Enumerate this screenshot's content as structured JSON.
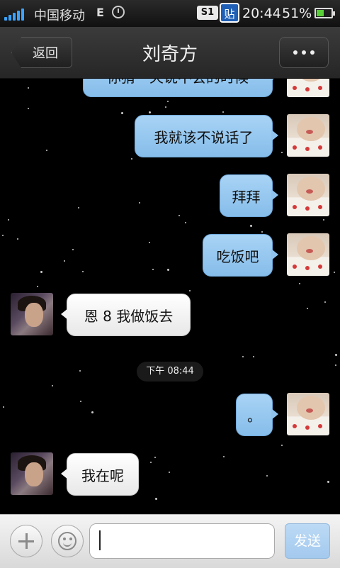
{
  "status_bar": {
    "carrier": "中国移动",
    "network": "E",
    "sim_label": "S1",
    "sticker_label": "贴",
    "time": "20:44",
    "battery_percent": "51%",
    "battery_level": 0.51
  },
  "header": {
    "back_label": "返回",
    "title": "刘奇方"
  },
  "messages": [
    {
      "side": "me",
      "text": "你猜一天说不会的时候"
    },
    {
      "side": "me",
      "text": "我就该不说话了"
    },
    {
      "side": "me",
      "text": "拜拜"
    },
    {
      "side": "me",
      "text": "吃饭吧"
    },
    {
      "side": "other",
      "text": "恩 8 我做饭去"
    },
    {
      "side": "me",
      "text": "。"
    },
    {
      "side": "other",
      "text": "我在呢"
    }
  ],
  "timestamp": "下午 08:44",
  "input": {
    "value": "",
    "send_label": "发送"
  },
  "colors": {
    "my_bubble": "#95c8f0",
    "other_bubble": "#f4f4f4",
    "background": "#000000"
  }
}
